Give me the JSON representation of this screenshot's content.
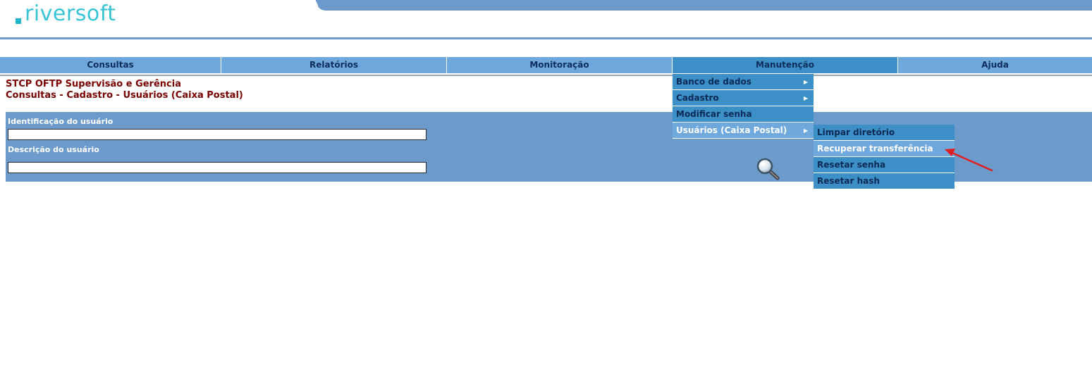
{
  "logo": {
    "text": "riversoft"
  },
  "nav": [
    {
      "label": "Consultas"
    },
    {
      "label": "Relatórios"
    },
    {
      "label": "Monitoração"
    },
    {
      "label": "Manutenção"
    },
    {
      "label": "Ajuda"
    }
  ],
  "title": {
    "line1": "STCP OFTP Supervisão e Gerência",
    "line2": "Consultas - Cadastro - Usuários (Caixa Postal)"
  },
  "form": {
    "user_id_label": "Identificação do usuário",
    "user_id_value": "",
    "user_desc_label": "Descrição do usuário",
    "user_desc_value": ""
  },
  "menu": [
    {
      "label": "Banco de dados",
      "has_submenu": true
    },
    {
      "label": "Cadastro",
      "has_submenu": true
    },
    {
      "label": "Modificar senha",
      "has_submenu": false
    },
    {
      "label": "Usuários (Caixa Postal)",
      "has_submenu": true
    }
  ],
  "submenu": [
    {
      "label": "Limpar diretório"
    },
    {
      "label": "Recuperar transferência"
    },
    {
      "label": "Resetar senha"
    },
    {
      "label": "Resetar hash"
    }
  ],
  "colors": {
    "header_blue": "#6b9acb",
    "nav_blue": "#6fa8dc",
    "menu_blue": "#3d8fc7",
    "title_red": "#7a0000",
    "logo_cyan": "#38c4d4",
    "annotation_red": "#e02020"
  },
  "icons": {
    "search": "magnifier-icon",
    "submenu_arrow": "triangle-right-icon"
  }
}
